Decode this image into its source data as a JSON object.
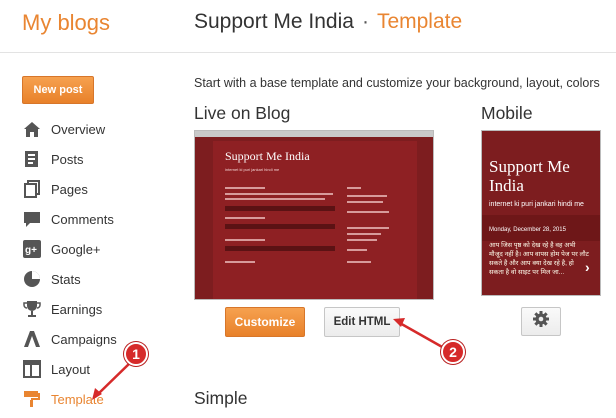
{
  "header": {
    "logo": "My blogs",
    "blog_name": "Support Me India",
    "separator": "·",
    "section": "Template"
  },
  "sidebar": {
    "new_post": "New post",
    "items": [
      {
        "label": "Overview",
        "icon": "home-icon"
      },
      {
        "label": "Posts",
        "icon": "posts-icon"
      },
      {
        "label": "Pages",
        "icon": "pages-icon"
      },
      {
        "label": "Comments",
        "icon": "comments-icon"
      },
      {
        "label": "Google+",
        "icon": "google-plus-icon"
      },
      {
        "label": "Stats",
        "icon": "stats-icon"
      },
      {
        "label": "Earnings",
        "icon": "trophy-icon"
      },
      {
        "label": "Campaigns",
        "icon": "campaigns-icon"
      },
      {
        "label": "Layout",
        "icon": "layout-icon"
      },
      {
        "label": "Template",
        "icon": "template-icon",
        "active": true
      }
    ]
  },
  "main": {
    "intro": "Start with a base template and customize your background, layout, colors",
    "live_heading": "Live on Blog",
    "mobile_heading": "Mobile",
    "simple_heading": "Simple",
    "live_preview": {
      "title": "Support Me India",
      "subtitle": "internet ki puri jankari hindi me"
    },
    "mobile_preview": {
      "title": "Support Me India",
      "subtitle": "internet ki puri jankari hindi me",
      "date": "Monday, December 28, 2015",
      "post": "आप जिस पृष्ठ को देख रहे है वह अभी मौजूद नहीं है। आप वापस होम पेज पर लौट सकते है और आप क्या देख रहे है, हो सकता है वो साइट पर मिल जा..."
    },
    "buttons": {
      "customize": "Customize",
      "edit_html": "Edit HTML"
    }
  },
  "annotations": [
    {
      "number": "1"
    },
    {
      "number": "2"
    }
  ],
  "colors": {
    "accent": "#e98531",
    "template_bg": "#7d1d1f",
    "annotation": "#d62a2a"
  }
}
